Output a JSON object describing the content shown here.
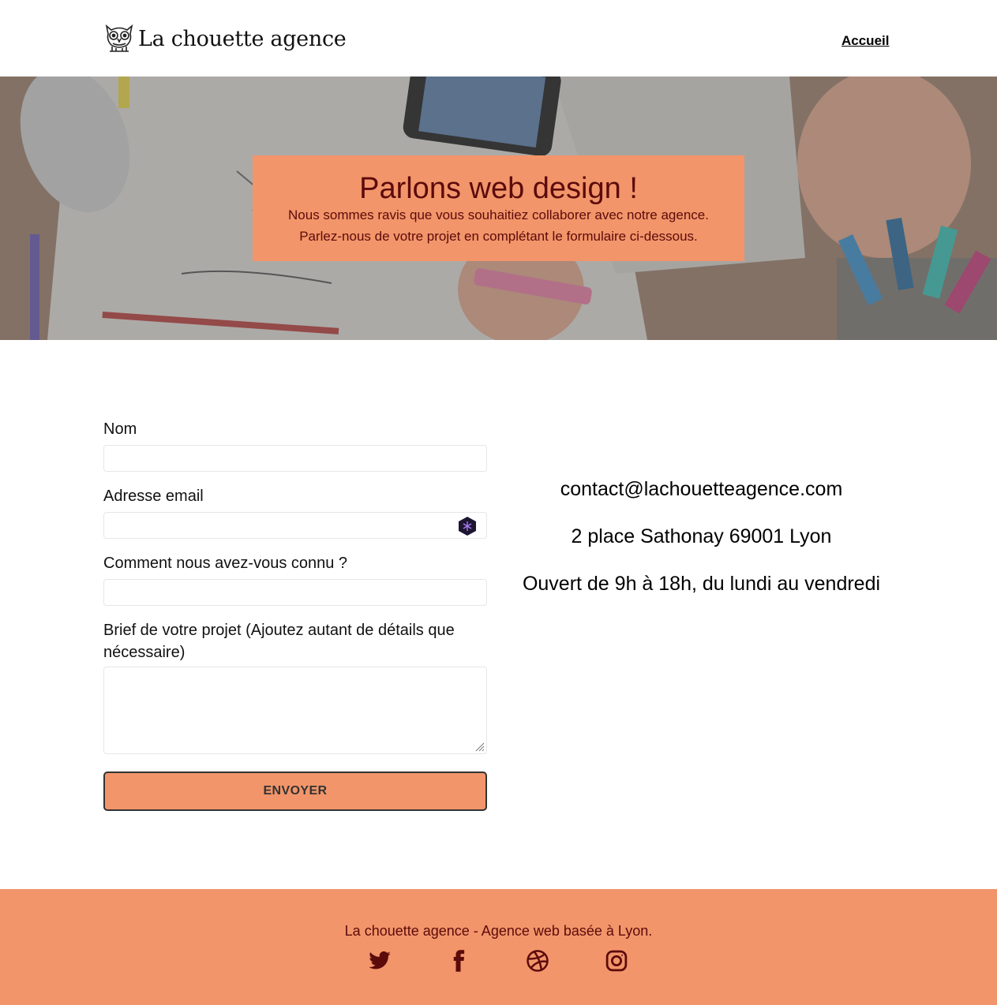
{
  "header": {
    "logo_text": "La chouette agence",
    "nav": {
      "home_label": "Accueil"
    }
  },
  "hero": {
    "title": "Parlons web design !",
    "line1": "Nous sommes ravis que vous souhaitiez collaborer avec notre agence.",
    "line2": "Parlez-nous de votre projet en complétant le formulaire ci-dessous."
  },
  "form": {
    "name_label": "Nom",
    "name_value": "",
    "email_label": "Adresse email",
    "email_value": "",
    "source_label": "Comment nous avez-vous connu ?",
    "source_value": "",
    "brief_label": "Brief de votre projet (Ajoutez autant de détails que nécessaire)",
    "brief_value": "",
    "submit_label": "ENVOYER"
  },
  "contact": {
    "email": "contact@lachouetteagence.com",
    "address": "2 place Sathonay 69001 Lyon",
    "hours": "Ouvert de 9h à 18h, du lundi au vendredi"
  },
  "footer": {
    "text": "La chouette agence - Agence web basée à Lyon.",
    "socials": [
      "twitter-icon",
      "facebook-icon",
      "dribbble-icon",
      "instagram-icon"
    ]
  },
  "colors": {
    "accent": "#f2956a",
    "accent_text": "#5c0b0b",
    "button_border": "#333333"
  }
}
